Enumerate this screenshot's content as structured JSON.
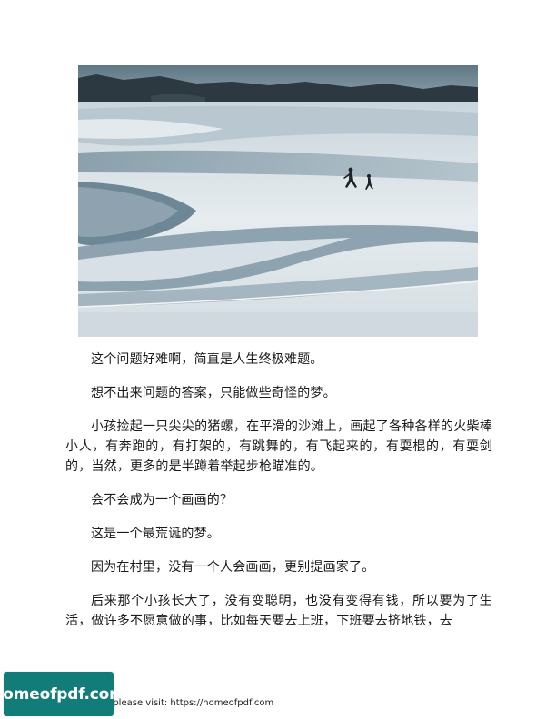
{
  "page": {
    "paragraphs": [
      "这个问题好难啊，简直是人生终极难题。",
      "想不出来问题的答案，只能做些奇怪的梦。",
      "小孩捡起一只尖尖的猪螺，在平滑的沙滩上，画起了各种各样的火柴棒小人，有奔跑的，有打架的，有跳舞的，有飞起来的，有耍棍的，有耍剑的，当然，更多的是半蹲着举起步枪瞄准的。",
      "会不会成为一个画画的？",
      "这是一个最荒诞的梦。",
      "因为在村里，没有一个人会画画，更别提画家了。",
      "后来那个小孩长大了，没有变聪明，也没有变得有钱，所以要为了生活，做许多不愿意做的事，比如每天要去上班，下班要去挤地铁，去"
    ]
  },
  "footer": {
    "logo_text": "homeofpdf.com",
    "notice": "e please visit: https://homeofpdf.com",
    "logo_color": "#117c78"
  }
}
